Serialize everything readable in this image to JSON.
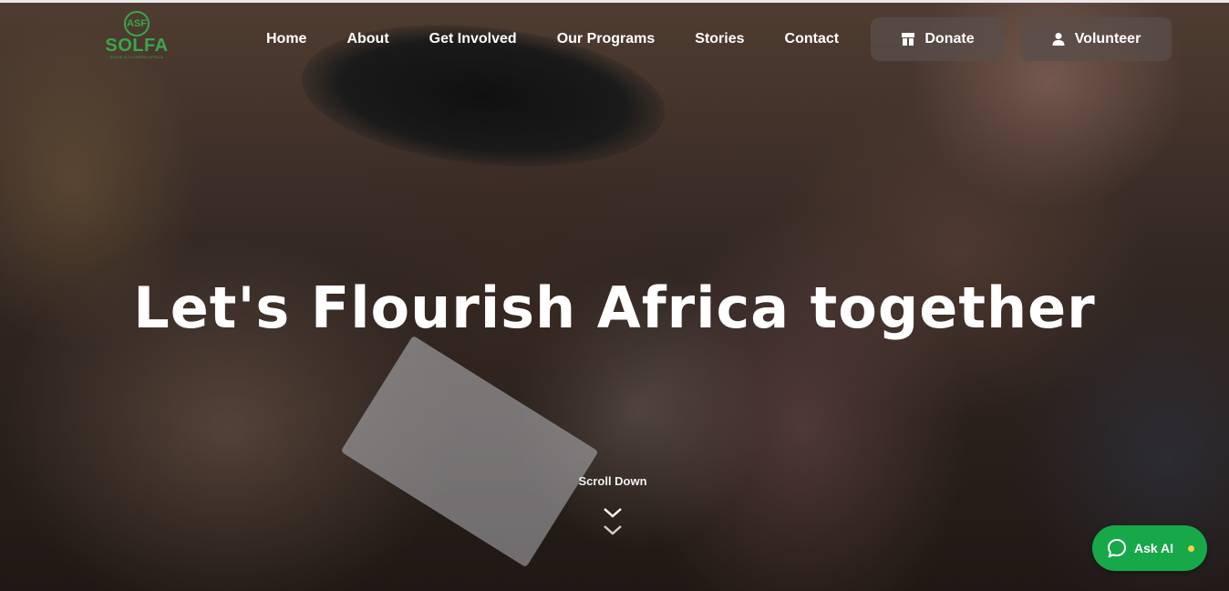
{
  "brand": {
    "mark": "ASF",
    "name": "SOLFA",
    "tagline": "SOLVE & FLOURISH AFRICA",
    "color": "#3aa64a"
  },
  "nav": {
    "items": [
      {
        "label": "Home"
      },
      {
        "label": "About"
      },
      {
        "label": "Get Involved"
      },
      {
        "label": "Our Programs"
      },
      {
        "label": "Stories"
      },
      {
        "label": "Contact"
      }
    ]
  },
  "actions": {
    "donate": {
      "label": "Donate",
      "icon": "donate-icon"
    },
    "volunteer": {
      "label": "Volunteer",
      "icon": "person-icon"
    }
  },
  "hero": {
    "headline": "Let's Flourish Africa together",
    "scroll_label": "Scroll Down",
    "scroll_icon": "double-chevron-down-icon"
  },
  "assistant": {
    "label": "Ask AI",
    "icon": "chat-bubble-icon",
    "button_color": "#17a84a",
    "status_color": "#f5d33b"
  }
}
